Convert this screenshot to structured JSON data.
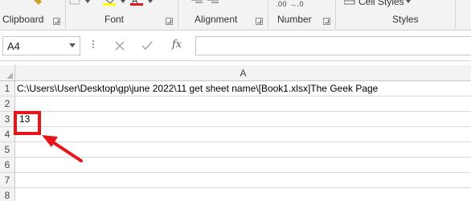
{
  "ribbon": {
    "groups": [
      {
        "label": "Clipboard",
        "launcher": true
      },
      {
        "label": "Font",
        "launcher": true
      },
      {
        "label": "Alignment",
        "launcher": true
      },
      {
        "label": "Number",
        "launcher": true
      },
      {
        "label": "Styles",
        "launcher": false
      }
    ],
    "number_decimal_text": ".00 →.0",
    "cell_styles_label": "Cell Styles",
    "accent": "#e8141a"
  },
  "formula_bar": {
    "name_box_value": "A4",
    "fx_label": "fx",
    "formula_value": ""
  },
  "sheet": {
    "column_headers": [
      "A"
    ],
    "rows": [
      {
        "num": "1",
        "a": "C:\\Users\\User\\Desktop\\gp\\june 2022\\11 get sheet name\\[Book1.xlsx]The Geek Page"
      },
      {
        "num": "2",
        "a": ""
      },
      {
        "num": "3",
        "a": "13"
      },
      {
        "num": "4",
        "a": ""
      },
      {
        "num": "5",
        "a": ""
      },
      {
        "num": "6",
        "a": ""
      },
      {
        "num": "7",
        "a": ""
      },
      {
        "num": "8",
        "a": ""
      }
    ]
  },
  "annotation": {
    "highlight_color": "#e8141a"
  }
}
